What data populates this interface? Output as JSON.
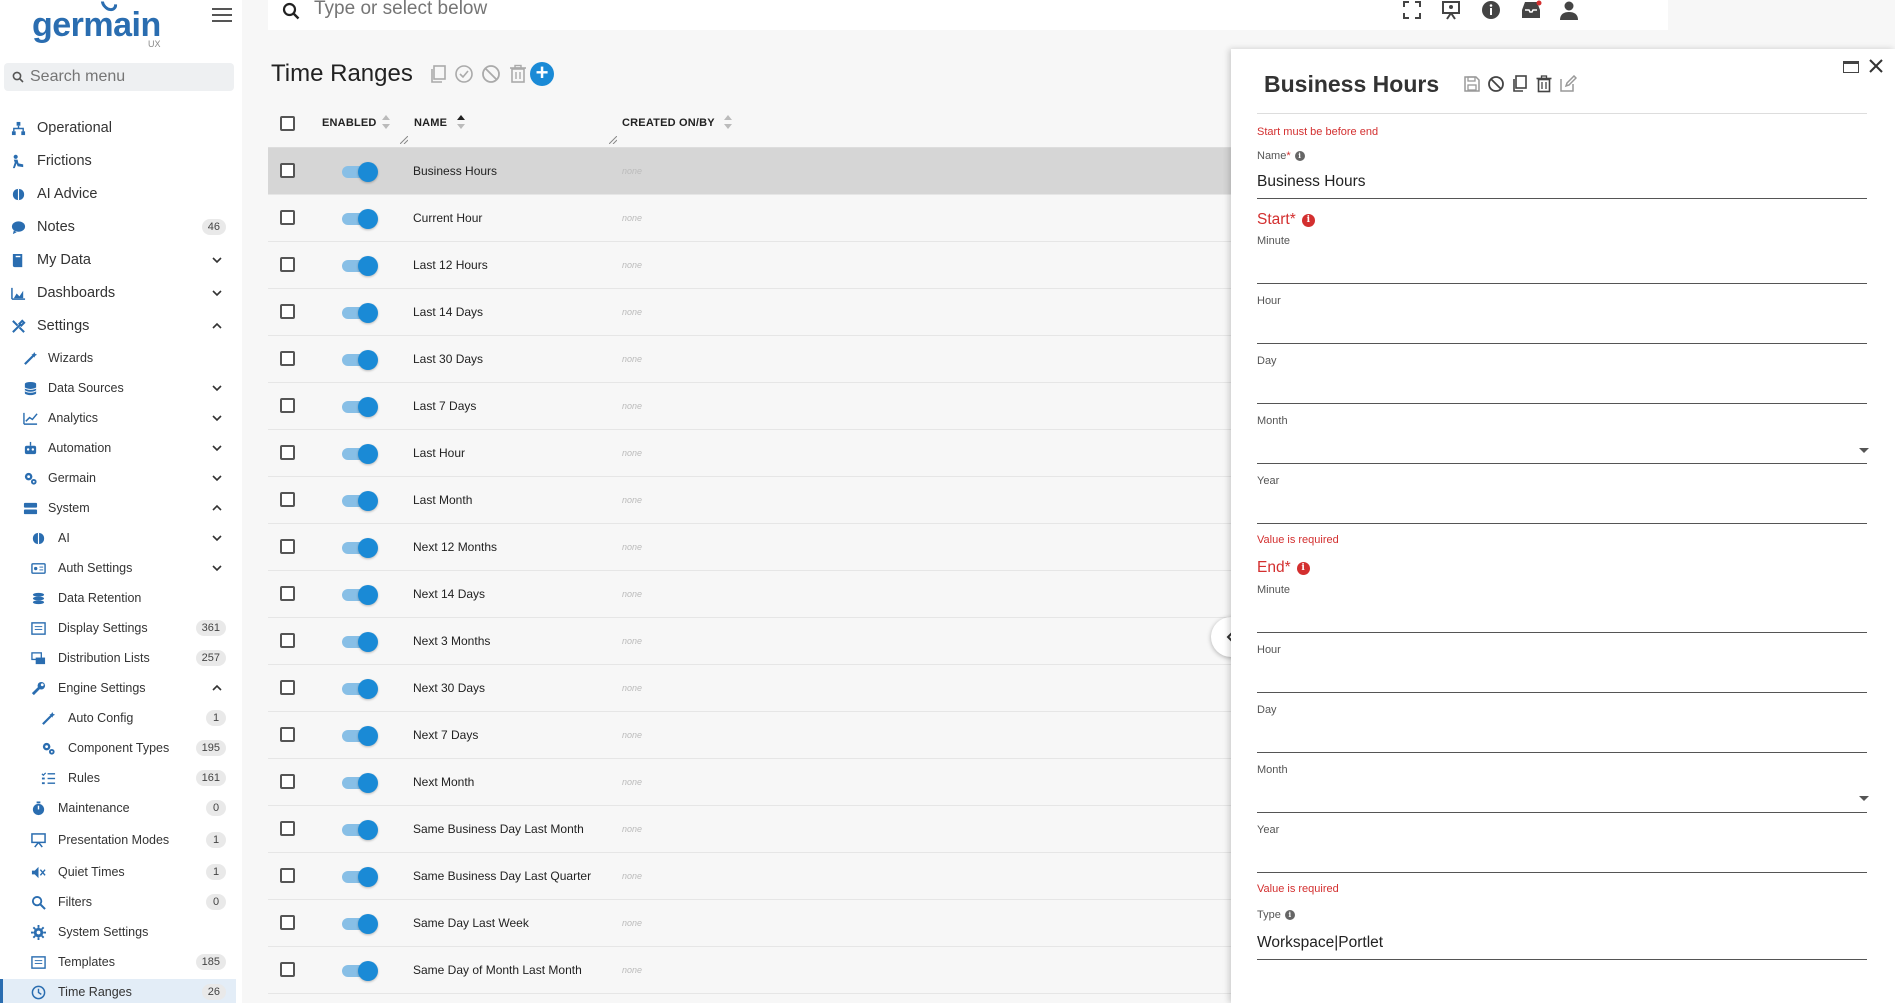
{
  "app": {
    "logo": "germain",
    "logo_sub": "UX",
    "menu_search_placeholder": "Search menu",
    "global_search_placeholder": "Type or select below"
  },
  "sidebar": {
    "items": [
      {
        "label": "Operational",
        "icon": "sitemap-icon"
      },
      {
        "label": "Frictions",
        "icon": "person-fall-icon"
      },
      {
        "label": "AI Advice",
        "icon": "brain-icon"
      },
      {
        "label": "Notes",
        "icon": "comment-icon",
        "count": "46"
      },
      {
        "label": "My Data",
        "icon": "book-icon",
        "chevron": "down"
      },
      {
        "label": "Dashboards",
        "icon": "area-chart-icon",
        "chevron": "down"
      },
      {
        "label": "Settings",
        "icon": "tools-icon",
        "chevron": "up"
      },
      {
        "label": "Wizards",
        "icon": "wand-icon"
      },
      {
        "label": "Data Sources",
        "icon": "database-icon",
        "chevron": "down"
      },
      {
        "label": "Analytics",
        "icon": "line-chart-icon",
        "chevron": "down"
      },
      {
        "label": "Automation",
        "icon": "robot-icon",
        "chevron": "down"
      },
      {
        "label": "Germain",
        "icon": "gears-icon",
        "chevron": "down"
      },
      {
        "label": "System",
        "icon": "server-icon",
        "chevron": "up"
      },
      {
        "label": "AI",
        "icon": "brain-icon",
        "chevron": "down"
      },
      {
        "label": "Auth Settings",
        "icon": "id-card-icon",
        "chevron": "down"
      },
      {
        "label": "Data Retention",
        "icon": "coins-icon"
      },
      {
        "label": "Display Settings",
        "icon": "list-alt-icon",
        "count": "361"
      },
      {
        "label": "Distribution Lists",
        "icon": "mail-bulk-icon",
        "count": "257"
      },
      {
        "label": "Engine Settings",
        "icon": "wrench-icon",
        "chevron": "up"
      },
      {
        "label": "Auto Config",
        "icon": "wand-icon",
        "count": "1"
      },
      {
        "label": "Component Types",
        "icon": "gears-icon",
        "count": "195"
      },
      {
        "label": "Rules",
        "icon": "list-check-icon",
        "count": "161"
      },
      {
        "label": "Maintenance",
        "icon": "stopwatch-icon",
        "count": "0"
      },
      {
        "label": "Presentation Modes",
        "icon": "presentation-icon",
        "count": "1"
      },
      {
        "label": "Quiet Times",
        "icon": "volume-mute-icon",
        "count": "1"
      },
      {
        "label": "Filters",
        "icon": "search-icon",
        "count": "0"
      },
      {
        "label": "System Settings",
        "icon": "gear-icon"
      },
      {
        "label": "Templates",
        "icon": "list-alt-icon",
        "count": "185"
      },
      {
        "label": "Time Ranges",
        "icon": "clock-icon",
        "count": "26"
      }
    ]
  },
  "main": {
    "title": "Time Ranges",
    "columns": {
      "enabled": "ENABLED",
      "name": "NAME",
      "created": "CREATED ON/BY"
    },
    "rows": [
      {
        "name": "Business Hours",
        "created": "none",
        "selected": true
      },
      {
        "name": "Current Hour",
        "created": "none"
      },
      {
        "name": "Last 12 Hours",
        "created": "none"
      },
      {
        "name": "Last 14 Days",
        "created": "none"
      },
      {
        "name": "Last 30 Days",
        "created": "none"
      },
      {
        "name": "Last 7 Days",
        "created": "none"
      },
      {
        "name": "Last Hour",
        "created": "none"
      },
      {
        "name": "Last Month",
        "created": "none"
      },
      {
        "name": "Next 12 Months",
        "created": "none"
      },
      {
        "name": "Next 14 Days",
        "created": "none"
      },
      {
        "name": "Next 3 Months",
        "created": "none"
      },
      {
        "name": "Next 30 Days",
        "created": "none"
      },
      {
        "name": "Next 7 Days",
        "created": "none"
      },
      {
        "name": "Next Month",
        "created": "none"
      },
      {
        "name": "Same Business Day Last Month",
        "created": "none"
      },
      {
        "name": "Same Business Day Last Quarter",
        "created": "none"
      },
      {
        "name": "Same Day Last Week",
        "created": "none"
      },
      {
        "name": "Same Day of Month Last Month",
        "created": "none"
      }
    ]
  },
  "panel": {
    "title": "Business Hours",
    "start_error": "Start must be before end",
    "name_label": "Name",
    "name_value": "Business Hours",
    "start_label": "Start",
    "end_label": "End",
    "minute_label": "Minute",
    "hour_label": "Hour",
    "day_label": "Day",
    "month_label": "Month",
    "year_label": "Year",
    "value_required": "Value is required",
    "type_label": "Type",
    "type_value": "Workspace|Portlet",
    "required_mark": "*"
  },
  "colors": {
    "accent": "#1a8ad6",
    "logo": "#2a6db0",
    "error": "#d32f2f"
  }
}
